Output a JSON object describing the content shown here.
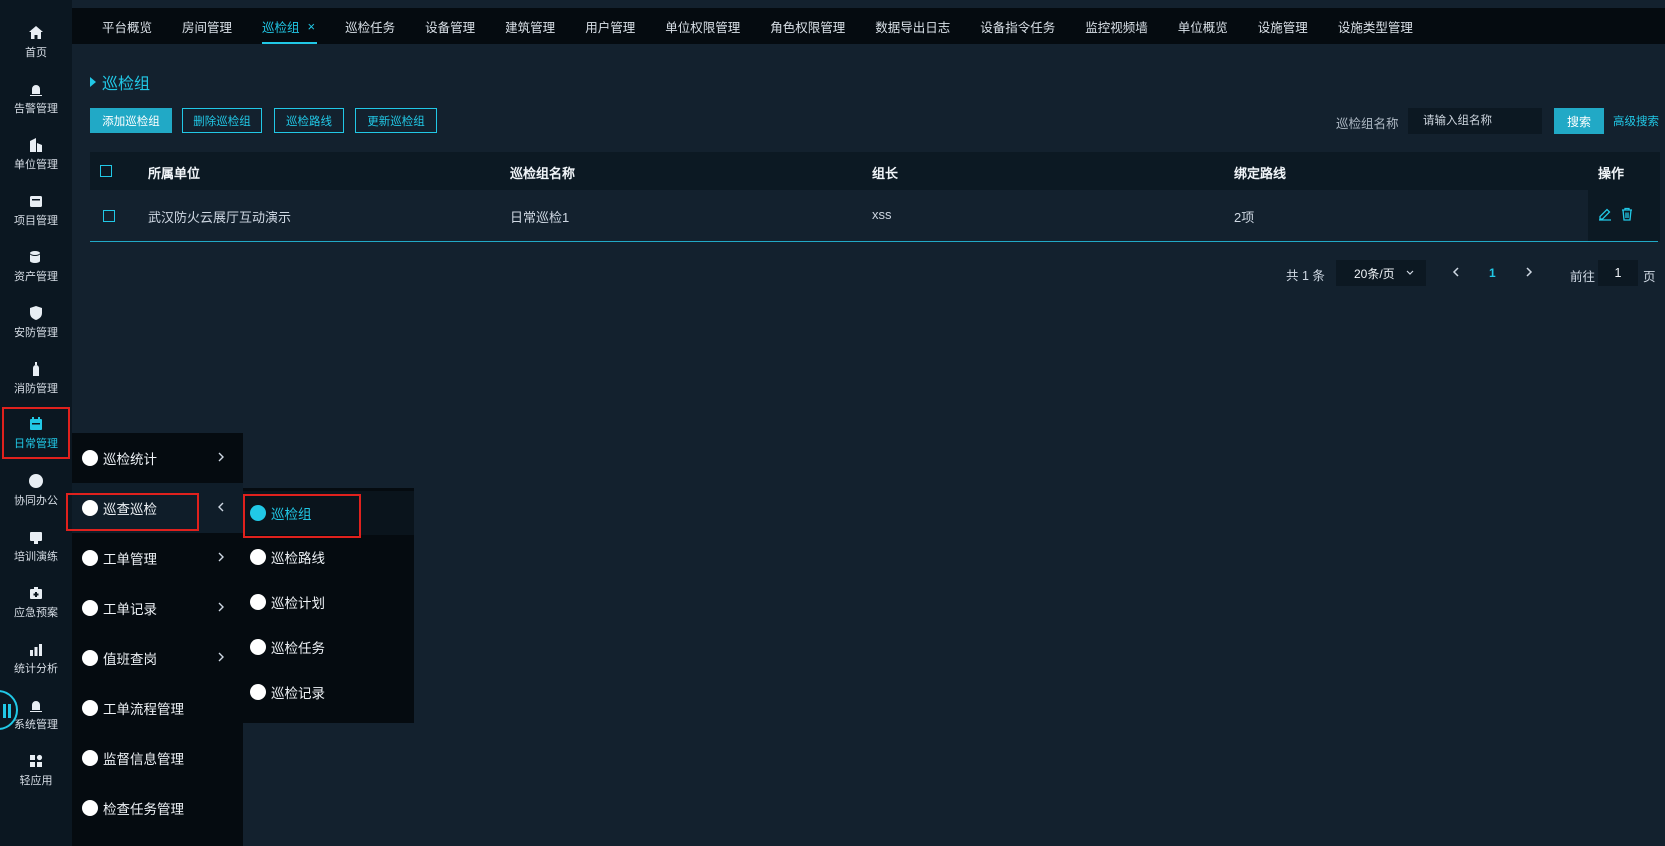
{
  "tabs": [
    {
      "label": "平台概览"
    },
    {
      "label": "房间管理"
    },
    {
      "label": "巡检组",
      "close": "×"
    },
    {
      "label": "巡检任务"
    },
    {
      "label": "设备管理"
    },
    {
      "label": "建筑管理"
    },
    {
      "label": "用户管理"
    },
    {
      "label": "单位权限管理"
    },
    {
      "label": "角色权限管理"
    },
    {
      "label": "数据导出日志"
    },
    {
      "label": "设备指令任务"
    },
    {
      "label": "监控视频墙"
    },
    {
      "label": "单位概览"
    },
    {
      "label": "设施管理"
    },
    {
      "label": "设施类型管理"
    }
  ],
  "sidebar": [
    {
      "label": "首页",
      "icon": "home-icon"
    },
    {
      "label": "告警管理",
      "icon": "alarm-icon"
    },
    {
      "label": "单位管理",
      "icon": "building-icon"
    },
    {
      "label": "项目管理",
      "icon": "folder-icon"
    },
    {
      "label": "资产管理",
      "icon": "asset-icon"
    },
    {
      "label": "安防管理",
      "icon": "shield-icon"
    },
    {
      "label": "消防管理",
      "icon": "fire-icon"
    },
    {
      "label": "日常管理",
      "icon": "calendar-icon"
    },
    {
      "label": "协同办公",
      "icon": "circle-icon"
    },
    {
      "label": "培训演练",
      "icon": "training-icon"
    },
    {
      "label": "应急预案",
      "icon": "emergency-icon"
    },
    {
      "label": "统计分析",
      "icon": "chart-icon"
    },
    {
      "label": "系统管理",
      "icon": "system-icon"
    },
    {
      "label": "轻应用",
      "icon": "apps-icon"
    }
  ],
  "page": {
    "title": "巡检组"
  },
  "toolbar": {
    "add": "添加巡检组",
    "delete": "删除巡检组",
    "route": "巡检路线",
    "update": "更新巡检组"
  },
  "search": {
    "label": "巡检组名称",
    "placeholder": "请输入组名称",
    "button": "搜索",
    "advanced": "高级搜索"
  },
  "table": {
    "headers": [
      "所属单位",
      "巡检组名称",
      "组长",
      "绑定路线",
      "操作"
    ],
    "rows": [
      {
        "unit": "武汉防火云展厅互动演示",
        "name": "日常巡检1",
        "leader": "xss",
        "routes": "2项"
      }
    ]
  },
  "pagination": {
    "total": "共 1 条",
    "page_size": "20条/页",
    "current": "1",
    "goto_label": "前往",
    "goto_value": "1",
    "page_suffix": "页"
  },
  "menu_level1": [
    {
      "label": "巡检统计"
    },
    {
      "label": "巡查巡检"
    },
    {
      "label": "工单管理"
    },
    {
      "label": "工单记录"
    },
    {
      "label": "值班查岗"
    },
    {
      "label": "工单流程管理"
    },
    {
      "label": "监督信息管理"
    },
    {
      "label": "检查任务管理"
    }
  ],
  "menu_level2": [
    {
      "label": "巡检组"
    },
    {
      "label": "巡检路线"
    },
    {
      "label": "巡检计划"
    },
    {
      "label": "巡检任务"
    },
    {
      "label": "巡检记录"
    }
  ],
  "colors": {
    "accent": "#21c8e6",
    "highlight": "#e0211d",
    "background": "#13212e"
  }
}
